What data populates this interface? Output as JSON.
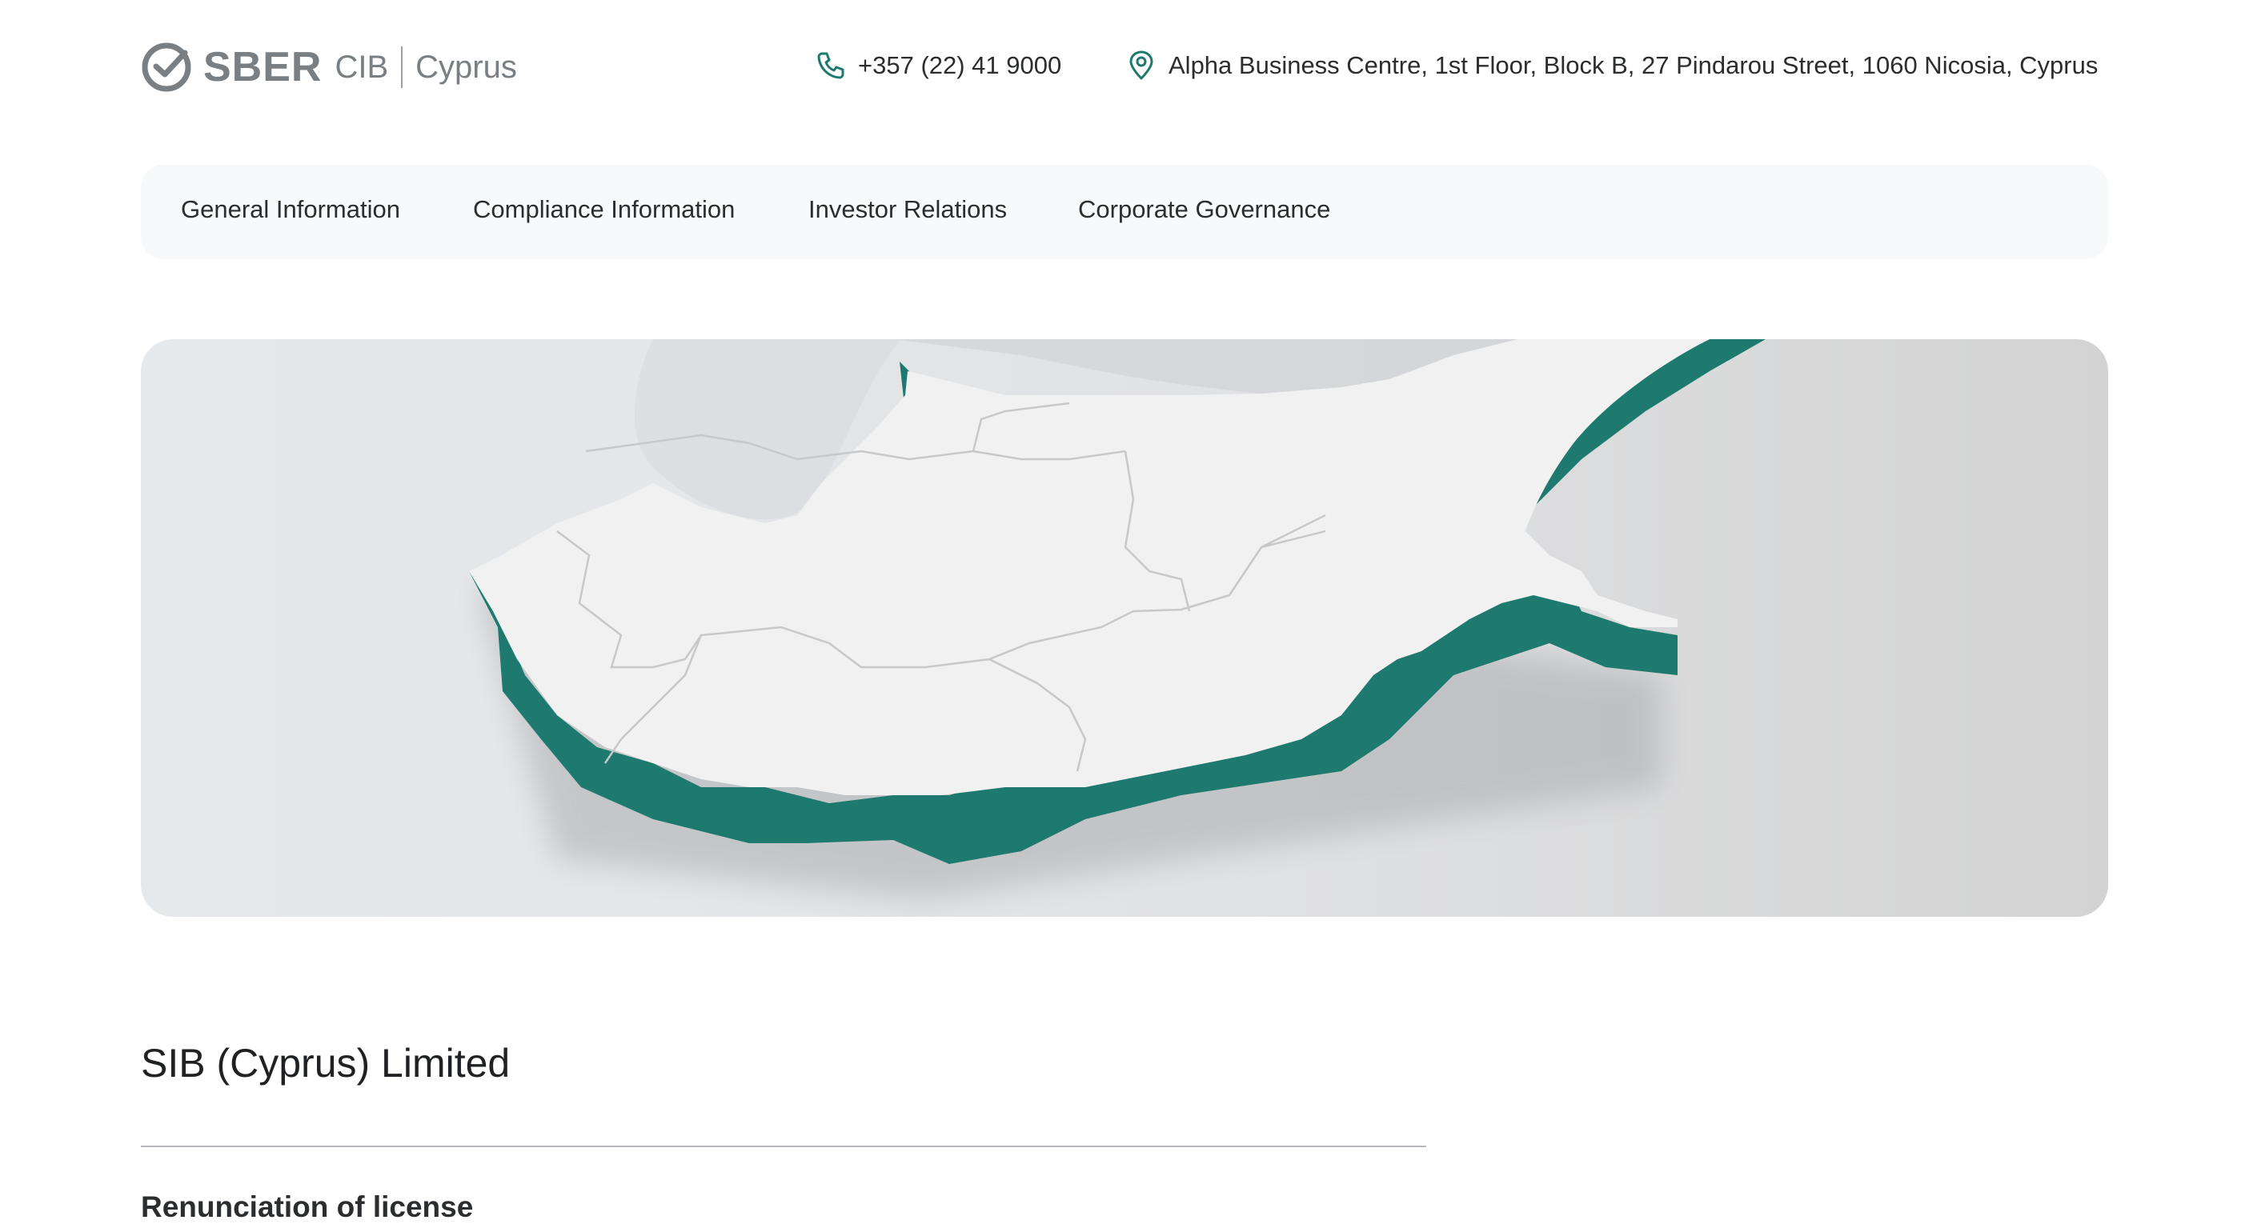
{
  "brand": {
    "name": "SBER",
    "unit": "CIB",
    "country": "Cyprus"
  },
  "header": {
    "phone": "+357 (22) 41 9000",
    "address": "Alpha Business Centre, 1st Floor, Block B, 27 Pindarou Street, 1060 Nicosia, Cyprus"
  },
  "nav": {
    "items": [
      {
        "label": "General Information"
      },
      {
        "label": "Compliance Information"
      },
      {
        "label": "Investor Relations"
      },
      {
        "label": "Corporate Governance"
      }
    ]
  },
  "main": {
    "title": "SIB (Cyprus) Limited",
    "section_heading": "Renunciation of license"
  },
  "icons": {
    "logo": "sber-check-icon",
    "phone": "phone-icon",
    "address": "location-pin-icon"
  },
  "colors": {
    "accent": "#1e7a6e",
    "logo_gray": "#7a7f84",
    "nav_bg": "#f8f9fa"
  }
}
